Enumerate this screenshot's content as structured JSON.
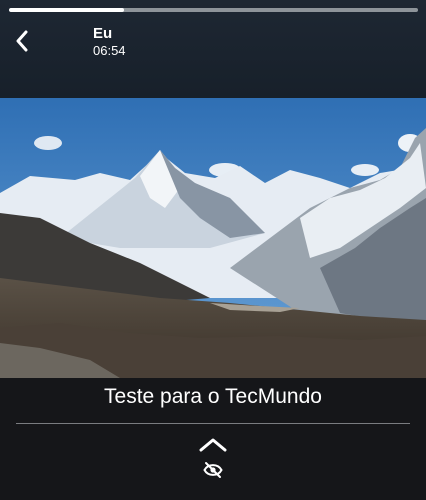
{
  "story": {
    "progress": 0.28,
    "user_name": "Eu",
    "time": "06:54",
    "caption": "Teste para o TecMundo"
  },
  "icons": {
    "back": "chevron-left-icon",
    "expand": "chevron-up-icon",
    "views": "eye-slash-icon"
  },
  "colors": {
    "header_bg": "#1b2530",
    "footer_bg": "#151619",
    "sky": "#3f80c2",
    "progress_track": "#8e949a",
    "progress_fill": "#ffffff"
  }
}
